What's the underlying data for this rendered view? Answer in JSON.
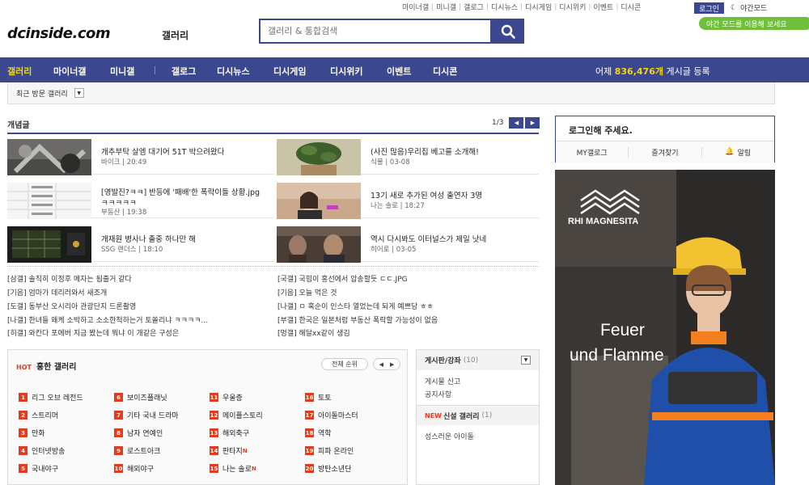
{
  "top_nav": {
    "links": [
      "마이너갤",
      "미니갤",
      "갤로그",
      "디시뉴스",
      "디시게임",
      "디시위키",
      "이벤트",
      "디시콘"
    ],
    "login_label": "로그인",
    "night_mode_label": "야간모드",
    "night_tooltip": "야간 모드를 이용해 보세요"
  },
  "header": {
    "logo_text": "dcinside.com",
    "logo_sub": "갤러리",
    "search_placeholder": "갤러리 & 통합검색"
  },
  "gnb": {
    "items": [
      "갤러리",
      "마이너갤",
      "미니갤",
      "갤로그",
      "디시뉴스",
      "디시게임",
      "디시위키",
      "이벤트",
      "디시콘"
    ],
    "post_count_prefix": "어제",
    "post_count": "836,476개",
    "post_count_suffix": "게시글 등록"
  },
  "recent": {
    "label": "최근 방문 갤러리"
  },
  "concept": {
    "title": "개념글",
    "page": "1/3",
    "items": [
      {
        "title": "개추부탁 살엠 대기어 51T 박으려왔다",
        "meta": "바이크 | 20:49"
      },
      {
        "title": "(사진 많음)우리집 베고를 소개해!",
        "meta": "식물 | 03-08"
      },
      {
        "title": "[영발진?ㅋㅋ] 반등에 '패배'한 폭락이들 상황.jpg ㅋㅋㅋㅋㅋ",
        "meta": "부동산 | 19:38"
      },
      {
        "title": "13기 새로 추가된 여성 출연자 3명",
        "meta": "나는 솔로 | 18:27"
      },
      {
        "title": "개재원 병사나 출중 하나만 해",
        "meta": "SSG 랜더스 | 18:10"
      },
      {
        "title": "역시 다시봐도 이터널스가 제일 낫네",
        "meta": "히어로 | 03-05"
      }
    ]
  },
  "issues": [
    {
      "cat": "[삼갤]",
      "text": "솔직히 이정후 메자는 됨출거 같다"
    },
    {
      "cat": "[국갤]",
      "text": "국힘이 홍선에서 압송할듯 ㄷㄷ.JPG"
    },
    {
      "cat": "[기음]",
      "text": "엄마가 데리러와서 새조개"
    },
    {
      "cat": "[기음]",
      "text": "오늘 먹은 것"
    },
    {
      "cat": "[도갤]",
      "text": "동부산 오시리아 관광단지 드론촬영"
    },
    {
      "cat": "[나갤]",
      "text": "ㅁ 혹순이 인스타 열었는데 되게 예쁘당 ㅎㅎ"
    },
    {
      "cat": "[나갤]",
      "text": "한녀들 왜케 소박하고 소소한척하는거 토쏠리냐 ㅋㅋㅋㅋ..."
    },
    {
      "cat": "[부갤]",
      "text": "한국은 일본처럼 부동산 폭락할 가능성이 없음"
    },
    {
      "cat": "[히갤]",
      "text": "와칸다 포에버 지금 봤는데 뭐냐 이 개같은 구성은"
    },
    {
      "cat": "[멍갤]",
      "text": "해달xx같이 생김"
    }
  ],
  "hot": {
    "badge": "HOT",
    "title": "흥한 갤러리",
    "rank_all": "전체 순위",
    "galleries": [
      {
        "num": "1",
        "name": "리그 오브 레전드",
        "new": ""
      },
      {
        "num": "2",
        "name": "스트리머",
        "new": ""
      },
      {
        "num": "3",
        "name": "만화",
        "new": ""
      },
      {
        "num": "4",
        "name": "인터넷방송",
        "new": ""
      },
      {
        "num": "5",
        "name": "국내야구",
        "new": ""
      },
      {
        "num": "6",
        "name": "보이즈플래닛",
        "new": ""
      },
      {
        "num": "7",
        "name": "기타 국내 드라마",
        "new": ""
      },
      {
        "num": "8",
        "name": "남자 연예인",
        "new": ""
      },
      {
        "num": "9",
        "name": "로스트아크",
        "new": ""
      },
      {
        "num": "10",
        "name": "해외야구",
        "new": ""
      },
      {
        "num": "11",
        "name": "우울증",
        "new": ""
      },
      {
        "num": "12",
        "name": "메이플스토리",
        "new": ""
      },
      {
        "num": "13",
        "name": "해외축구",
        "new": ""
      },
      {
        "num": "14",
        "name": "판타지",
        "new": "N"
      },
      {
        "num": "15",
        "name": "나는 솔로",
        "new": "N"
      },
      {
        "num": "16",
        "name": "토토",
        "new": ""
      },
      {
        "num": "17",
        "name": "아이돌마스터",
        "new": ""
      },
      {
        "num": "18",
        "name": "역학",
        "new": ""
      },
      {
        "num": "19",
        "name": "피파 온라인",
        "new": ""
      },
      {
        "num": "20",
        "name": "방탄소년단",
        "new": ""
      }
    ]
  },
  "side": {
    "board_title": "게시판/강좌",
    "board_count": "(10)",
    "board_links": [
      "게시물 신고",
      "공지사항"
    ],
    "new_badge": "NEW",
    "new_title": "신설 갤러리",
    "new_count": "(1)",
    "new_links": [
      "성스러운 아이돌"
    ]
  },
  "login_box": {
    "message": "로그인해 주세요.",
    "tools": [
      "MY갤로그",
      "즐겨찾기",
      "알림"
    ]
  },
  "ad": {
    "brand": "RHI MAGNESITA",
    "headline_1": "Feuer",
    "headline_2": "und Flamme"
  },
  "colors": {
    "brand": "#3b4890",
    "accent_yellow": "#f5d800",
    "hot_red": "#e53b1d",
    "tip_green": "#6fbf3b"
  }
}
